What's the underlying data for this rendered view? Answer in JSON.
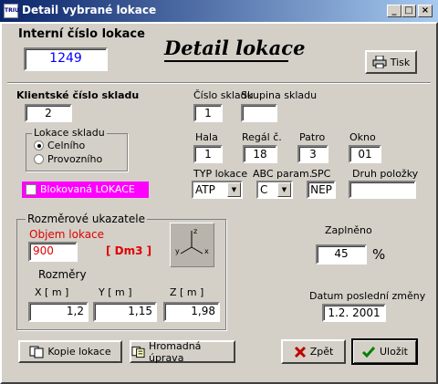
{
  "window": {
    "title": "Detail vybrané lokace",
    "minimize": "_",
    "maximize": "□",
    "close": "×"
  },
  "internal": {
    "label": "Interní číslo lokace",
    "value": "1249"
  },
  "heading": "Detail lokace",
  "print_button": "Tisk",
  "client": {
    "label": "Klientské číslo skladu",
    "value": "2"
  },
  "storage_type": {
    "label": "Lokace skladu",
    "options": [
      "Celního",
      "Provozního"
    ],
    "selected": "Celního"
  },
  "blocked": {
    "label": "Blokovaná LOKACE",
    "checked": false
  },
  "warehouse": {
    "label": "Číslo skladu",
    "value": "1"
  },
  "group": {
    "label": "Skupina skladu",
    "value": ""
  },
  "hall": {
    "label": "Hala",
    "value": "1"
  },
  "rack": {
    "label": "Regál č.",
    "value": "18"
  },
  "floor": {
    "label": "Patro",
    "value": "3"
  },
  "window_no": {
    "label": "Okno",
    "value": "01"
  },
  "type": {
    "label": "TYP lokace",
    "value": "ATP"
  },
  "abc": {
    "label": "ABC param.",
    "value": "C"
  },
  "spc": {
    "label": "SPC",
    "value": "NEP"
  },
  "item_type": {
    "label": "Druh položky",
    "value": ""
  },
  "dimensions": {
    "group_label": "Rozměrové ukazatele",
    "volume_label": "Objem lokace",
    "volume": "900",
    "unit": "[ Dm3 ]",
    "sizes_label": "Rozměry",
    "x_label": "X [ m ]",
    "x": "1,2",
    "y_label": "Y [ m ]",
    "y": "1,15",
    "z_label": "Z [ m ]",
    "z": "1,98",
    "axes": {
      "z": "z",
      "y": "y",
      "x": "x"
    }
  },
  "filled": {
    "label": "Zaplněno",
    "value": "45",
    "unit": "%"
  },
  "last_change": {
    "label": "Datum poslední změny",
    "value": "1.2. 2001"
  },
  "buttons": {
    "copy": "Kopie lokace",
    "bulk": "Hromadná úprava",
    "back": "Zpět",
    "save": "Uložit"
  }
}
